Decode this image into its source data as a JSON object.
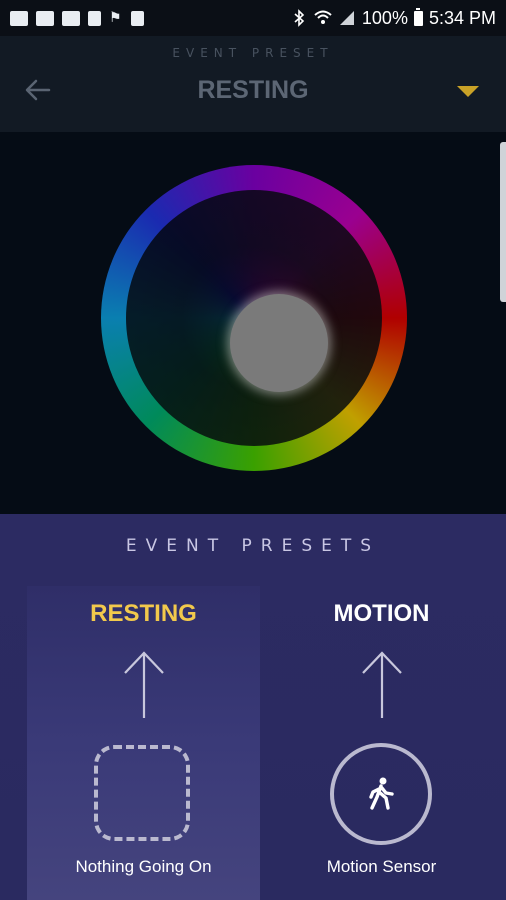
{
  "status_bar": {
    "battery": "100%",
    "time": "5:34 PM",
    "notification_icons": [
      "gmail-icon",
      "gmail-icon",
      "image-icon",
      "excel-icon",
      "flag-icon",
      "clipboard-icon"
    ],
    "system_icons": [
      "bluetooth-icon",
      "wifi-icon",
      "signal-icon",
      "battery-icon"
    ]
  },
  "header": {
    "subtitle": "EVENT PRESET",
    "title": "RESTING",
    "back_icon": "back-arrow-icon",
    "dropdown_icon": "dropdown-triangle-icon",
    "accent_color": "#c9a227"
  },
  "color_wheel": {
    "selected_color": "#7a7a7a"
  },
  "presets": {
    "title": "EVENT PRESETS",
    "items": [
      {
        "name": "RESTING",
        "label": "Nothing Going On",
        "name_color": "#f2c94c",
        "icon": "dashed-square-icon",
        "selected": true
      },
      {
        "name": "MOTION",
        "label": "Motion Sensor",
        "name_color": "#ffffff",
        "icon": "walking-person-icon",
        "selected": false
      }
    ]
  }
}
